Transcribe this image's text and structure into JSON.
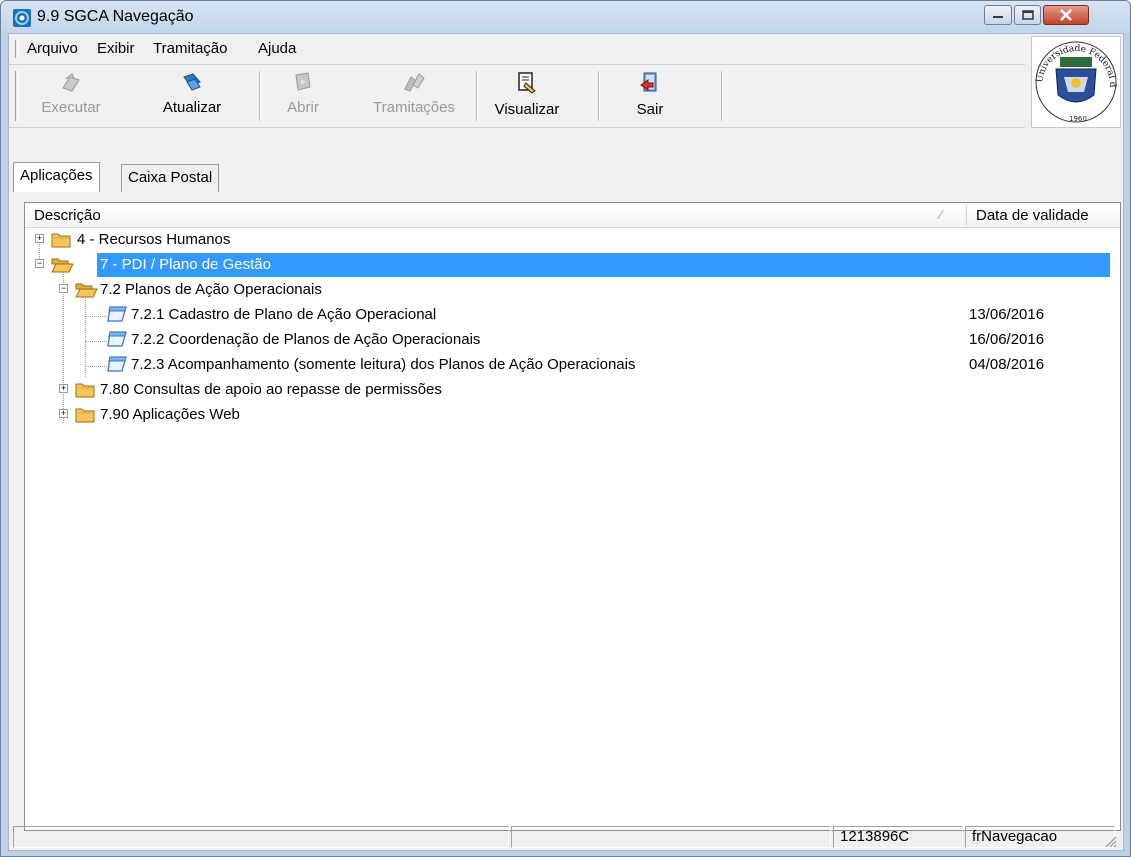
{
  "window": {
    "title": "9.9 SGCA Navegação"
  },
  "menu": [
    "Arquivo",
    "Exibir",
    "Tramitação",
    "Ajuda"
  ],
  "toolbar": {
    "execute": "Executar",
    "refresh": "Atualizar",
    "open": "Abrir",
    "tramitacoes": "Tramitações",
    "view": "Visualizar",
    "exit": "Sair"
  },
  "logo": {
    "text": "Universidade Federal de Santa Maria",
    "year": "1960"
  },
  "tabs": [
    "Aplicações",
    "Caixa Postal"
  ],
  "tree": {
    "columns": {
      "description": "Descrição",
      "validity": "Data de validade"
    },
    "rows": [
      {
        "label": "4 - Recursos Humanos",
        "date": ""
      },
      {
        "label": "7 - PDI / Plano de Gestão",
        "date": ""
      },
      {
        "label": "7.2 Planos de Ação Operacionais",
        "date": ""
      },
      {
        "label": "7.2.1 Cadastro de Plano de Ação Operacional",
        "date": "13/06/2016"
      },
      {
        "label": "7.2.2 Coordenação de Planos de Ação Operacionais",
        "date": "16/06/2016"
      },
      {
        "label": "7.2.3 Acompanhamento (somente leitura) dos Planos de Ação Operacionais",
        "date": "04/08/2016"
      },
      {
        "label": "7.80 Consultas de apoio ao repasse de permissões",
        "date": ""
      },
      {
        "label": "7.90 Aplicações Web",
        "date": ""
      }
    ]
  },
  "status": {
    "user": "1213896C",
    "form": "frNavegacao"
  },
  "colors": {
    "selection": "#3399ff",
    "folder": "#f5c55a",
    "window_frame": "#bcd0e6"
  }
}
